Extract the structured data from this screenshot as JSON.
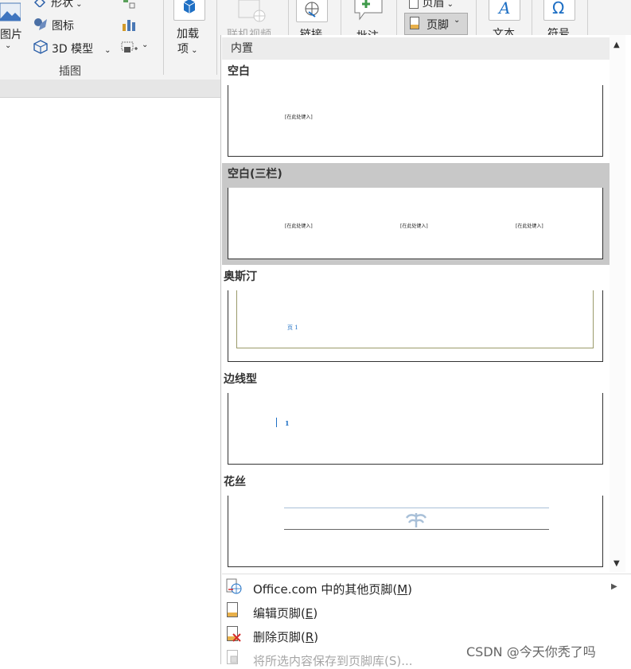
{
  "ribbon": {
    "picture_label": "图片",
    "shapes_label": "形状",
    "icons_label": "图标",
    "model3d_label": "3D 模型",
    "illustrations_group": "插图",
    "addins_label_1": "加载",
    "addins_label_2": "项",
    "online_video_label": "联机视频",
    "link_label": "链接",
    "comment_label": "批注",
    "header_label": "页眉",
    "footer_label": "页脚",
    "text_label": "文本",
    "symbol_label": "符号"
  },
  "gallery": {
    "section_header": "内置",
    "items": [
      {
        "title": "空白",
        "placeholders": [
          "[在此处键入]"
        ]
      },
      {
        "title": "空白(三栏)",
        "placeholders": [
          "[在此处键入]",
          "[在此处键入]",
          "[在此处键入]"
        ]
      },
      {
        "title": "奥斯汀",
        "preview_text": "页 1"
      },
      {
        "title": "边线型",
        "preview_text": "1"
      },
      {
        "title": "花丝"
      }
    ]
  },
  "menu": {
    "more_footers": {
      "before": "Office.com 中的其他页脚(",
      "key": "M",
      "after": ")"
    },
    "edit_footer": {
      "before": "编辑页脚(",
      "key": "E",
      "after": ")"
    },
    "remove_footer": {
      "before": "删除页脚(",
      "key": "R",
      "after": ")"
    },
    "save_selection": "将所选内容保存到页脚库(S)..."
  },
  "watermark": "CSDN @今天你秃了吗",
  "colors": {
    "ribbon_bg": "#f3f3f3",
    "selected_item_bg": "#c8c8c8",
    "accent_blue": "#1e6fc4",
    "austin_border": "#9a9a6a",
    "delete_red": "#d42b2b"
  }
}
